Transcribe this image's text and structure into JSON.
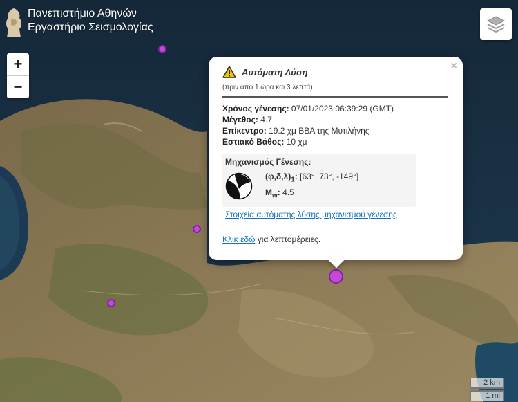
{
  "header": {
    "line1": "Πανεπιστήμιο Αθηνών",
    "line2": "Εργαστήριο Σεισμολογίας"
  },
  "zoom": {
    "in_label": "+",
    "out_label": "−"
  },
  "layers": {
    "icon": "layers-icon"
  },
  "popup": {
    "warning_icon": "warning-triangle-icon",
    "title": "Αυτόματη Λύση",
    "ago": "(πριν από 1 ώρα και 3 λεπτά)",
    "close_label": "×",
    "origin_time_label": "Χρόνος γένεσης:",
    "origin_time_value": "07/01/2023 06:39:29 (GMT)",
    "magnitude_label": "Μέγεθος:",
    "magnitude_value": "4.7",
    "epicenter_label": "Επίκεντρο:",
    "epicenter_value": "19.2 χμ ΒΒΑ της Μυτιλήνης",
    "depth_label": "Εστιακό Βάθος:",
    "depth_value": "10 χμ",
    "mechanism": {
      "title": "Μηχανισμός Γένεσης:",
      "angles_label": "(φ,δ,λ)",
      "angles_sub": "1",
      "angles_value": "[63°, 73°, -149°]",
      "mw_label": "M",
      "mw_sub": "w",
      "mw_value": "4.5",
      "link": "Στοιχεία αυτόματης λύσης μηχανισμού γένεσης"
    },
    "footer_link": "Κλικ εδώ",
    "footer_text": " για λεπτομέρειες."
  },
  "scale": {
    "km": "2 km",
    "mi": "1 mi"
  },
  "colors": {
    "marker": "#c24ad6",
    "link": "#1a73b8",
    "sea": "#1b3347"
  }
}
